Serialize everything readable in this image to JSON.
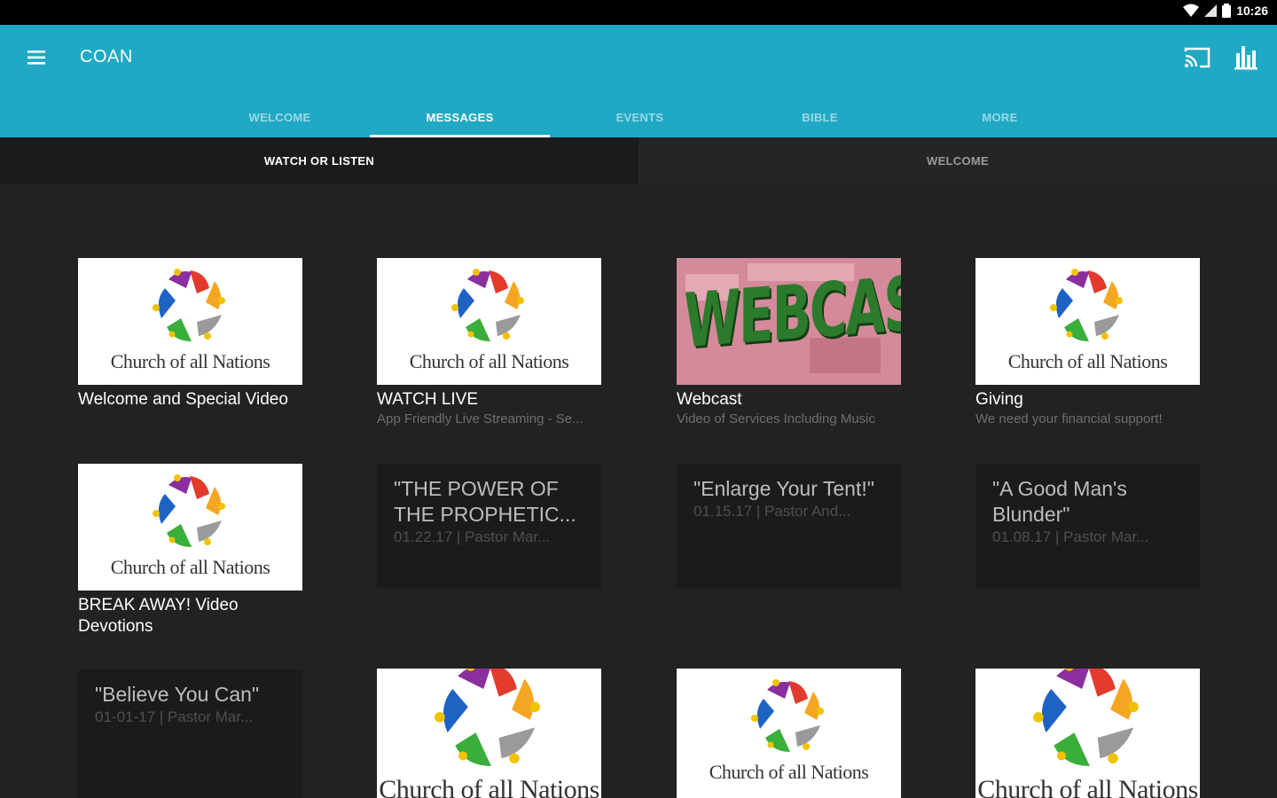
{
  "status": {
    "time": "10:26"
  },
  "app": {
    "title": "COAN"
  },
  "tabs": [
    "WELCOME",
    "MESSAGES",
    "EVENTS",
    "BIBLE",
    "MORE"
  ],
  "active_tab": "MESSAGES",
  "subtabs": [
    "WATCH OR LISTEN",
    "WELCOME"
  ],
  "logo_text": "Church of all Nations",
  "cards": [
    {
      "title": "Welcome and Special Video",
      "subtitle": ""
    },
    {
      "title": "WATCH LIVE",
      "subtitle": "App Friendly Live Streaming - Se..."
    },
    {
      "title": "Webcast",
      "subtitle": "Video of Services Including Music",
      "thumb_text": "WEBCAST"
    },
    {
      "title": "Giving",
      "subtitle": "We need your financial support!"
    },
    {
      "title": "BREAK AWAY!  Video Devotions",
      "subtitle": ""
    }
  ],
  "text_cards": [
    {
      "title": "\"THE POWER OF THE PROPHETIC...",
      "subtitle": "01.22.17 | Pastor Mar..."
    },
    {
      "title": "\"Enlarge Your Tent!\"",
      "subtitle": "01.15.17 | Pastor And..."
    },
    {
      "title": "\"A Good Man's Blunder\"",
      "subtitle": "01.08.17 | Pastor Mar..."
    },
    {
      "title": "\"Believe You Can\"",
      "subtitle": "01-01-17 | Pastor Mar..."
    }
  ],
  "colors": {
    "app_bar": "#1fa9c4",
    "background": "#222222",
    "card_dark": "#1b1b1b"
  }
}
